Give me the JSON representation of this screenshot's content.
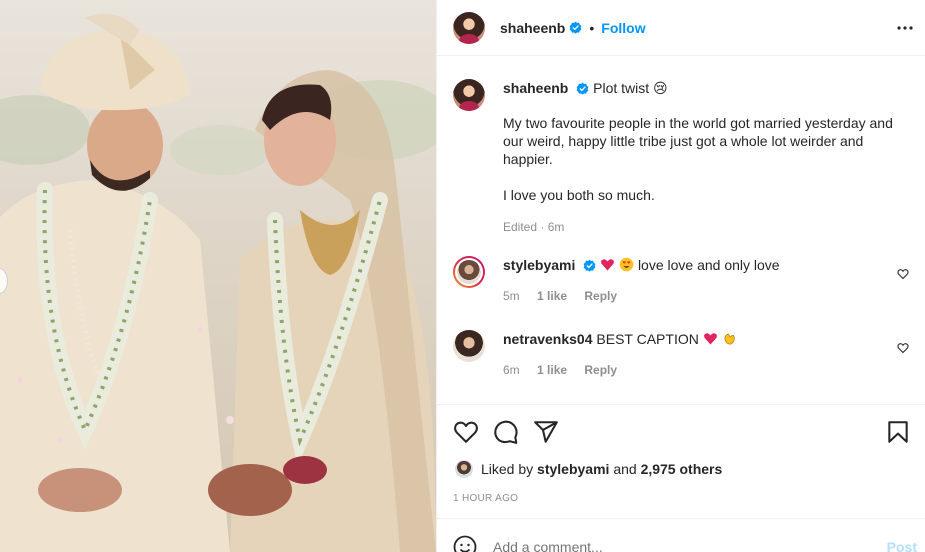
{
  "post": {
    "author": "shaheenb",
    "follow_label": "Follow",
    "separator": "•",
    "more_icon": "more-horizontal-icon"
  },
  "caption": {
    "username": "shaheenb",
    "headline": "Plot twist 😢",
    "text": "My two favourite people in the world got married yesterday and our weird, happy little tribe just got a whole lot weirder and happier.\n\nI love you both so much.",
    "meta": "Edited · 6m"
  },
  "comments": [
    {
      "username": "stylebyami",
      "text": "love love and only love",
      "time": "5m",
      "likes": "1 like",
      "reply": "Reply"
    },
    {
      "username": "netravenks04",
      "text": "BEST CAPTION",
      "time": "6m",
      "likes": "1 like",
      "reply": "Reply"
    }
  ],
  "likes": {
    "prefix": "Liked by",
    "user": "stylebyami",
    "joiner": "and",
    "others": "2,975 others"
  },
  "timestamp": "1 HOUR AGO",
  "composer": {
    "placeholder": "Add a comment...",
    "post_label": "Post"
  },
  "colors": {
    "accent": "#0095f6",
    "post_disabled": "#b2dffc",
    "heart": "#e0245e",
    "muted": "#8e8e8e"
  }
}
